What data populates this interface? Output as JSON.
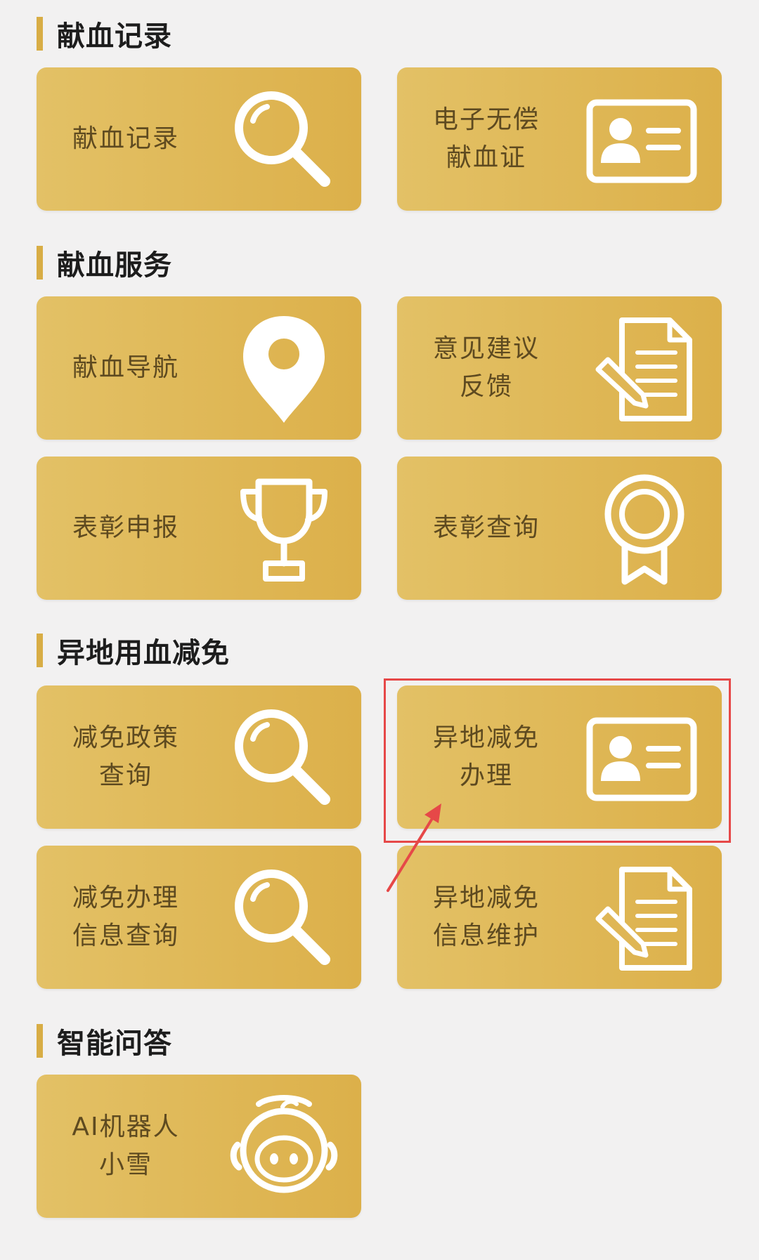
{
  "sections": [
    {
      "title": "献血记录",
      "cards": [
        {
          "lines": [
            "献血记录"
          ],
          "icon": "magnifier-icon"
        },
        {
          "lines": [
            "电子无偿",
            "献血证"
          ],
          "icon": "id-card-icon"
        }
      ]
    },
    {
      "title": "献血服务",
      "cards": [
        {
          "lines": [
            "献血导航"
          ],
          "icon": "location-pin-icon"
        },
        {
          "lines": [
            "意见建议",
            "反馈"
          ],
          "icon": "document-pen-icon"
        },
        {
          "lines": [
            "表彰申报"
          ],
          "icon": "trophy-icon"
        },
        {
          "lines": [
            "表彰查询"
          ],
          "icon": "award-ribbon-icon"
        }
      ]
    },
    {
      "title": "异地用血减免",
      "cards": [
        {
          "lines": [
            "减免政策",
            "查询"
          ],
          "icon": "magnifier-icon"
        },
        {
          "lines": [
            "异地减免",
            "办理"
          ],
          "icon": "id-card-icon"
        },
        {
          "lines": [
            "减免办理",
            "信息查询"
          ],
          "icon": "magnifier-icon"
        },
        {
          "lines": [
            "异地减免",
            "信息维护"
          ],
          "icon": "document-pen-icon"
        }
      ]
    },
    {
      "title": "智能问答",
      "cards": [
        {
          "lines": [
            "AI机器人",
            "小雪"
          ],
          "icon": "robot-icon"
        }
      ]
    }
  ],
  "colors": {
    "background": "#f2f1f1",
    "card": "#dfb655",
    "accent_bar": "#d8ad45",
    "card_text": "#5e4a20",
    "highlight": "#e64848"
  }
}
